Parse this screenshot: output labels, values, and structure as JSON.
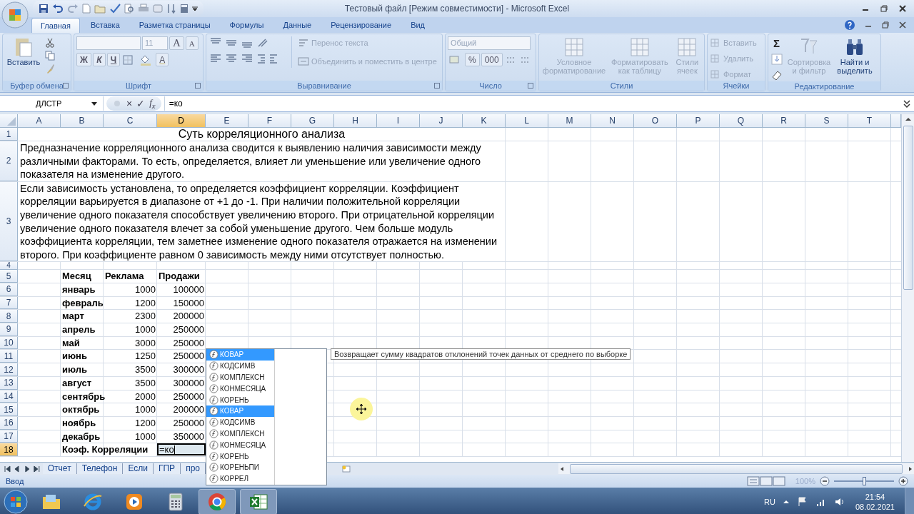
{
  "window": {
    "title": "Тестовый файл  [Режим совместимости] - Microsoft Excel"
  },
  "tabs": [
    {
      "label": "Главная",
      "selected": true
    },
    {
      "label": "Вставка",
      "selected": false
    },
    {
      "label": "Разметка страницы",
      "selected": false
    },
    {
      "label": "Формулы",
      "selected": false
    },
    {
      "label": "Данные",
      "selected": false
    },
    {
      "label": "Рецензирование",
      "selected": false
    },
    {
      "label": "Вид",
      "selected": false
    }
  ],
  "ribbon": {
    "clipboard": {
      "label": "Буфер обмена",
      "paste": {
        "label": "Вставить",
        "disabled": false
      }
    },
    "font": {
      "label": "Шрифт",
      "size": "11",
      "grow": "A",
      "shrink": "A",
      "styles": [
        "Ж",
        "К",
        "Ч"
      ],
      "color_button": "A"
    },
    "alignment": {
      "label": "Выравнивание",
      "wrap": {
        "label": "Перенос текста",
        "disabled": true
      },
      "merge": {
        "label": "Объединить и поместить в центре",
        "disabled": true
      }
    },
    "number": {
      "label": "Число",
      "format": {
        "label": "Общий",
        "disabled": true
      },
      "percent": "%",
      "thousands": "000"
    },
    "styles": {
      "label": "Стили",
      "buttons": [
        {
          "label": "Условное форматирование",
          "disabled": true
        },
        {
          "label": "Форматировать как таблицу",
          "disabled": true
        },
        {
          "label": "Стили ячеек",
          "disabled": true
        }
      ]
    },
    "cells": {
      "label": "Ячейки",
      "buttons": [
        {
          "label": "Вставить",
          "disabled": true
        },
        {
          "label": "Удалить",
          "disabled": true
        },
        {
          "label": "Формат",
          "disabled": true
        }
      ]
    },
    "editing": {
      "label": "Редактирование",
      "sum": "Σ",
      "sort": {
        "label": "Сортировка и фильтр",
        "disabled": true
      },
      "find": {
        "label": "Найти и выделить",
        "disabled": false
      }
    }
  },
  "formula_bar": {
    "name_box": "ДЛСТР",
    "cancel": "×",
    "enter": "✓",
    "function": "f$_{x}$",
    "formula": "=ко"
  },
  "sheet": {
    "columns": [
      {
        "label": "A",
        "selected": false
      },
      {
        "label": "B",
        "selected": false
      },
      {
        "label": "C",
        "selected": false
      },
      {
        "label": "D",
        "selected": true
      },
      {
        "label": "E",
        "selected": false
      },
      {
        "label": "F",
        "selected": false
      },
      {
        "label": "G",
        "selected": false
      },
      {
        "label": "H",
        "selected": false
      },
      {
        "label": "I",
        "selected": false
      },
      {
        "label": "J",
        "selected": false
      },
      {
        "label": "K",
        "selected": false
      },
      {
        "label": "L",
        "selected": false
      },
      {
        "label": "M",
        "selected": false
      },
      {
        "label": "N",
        "selected": false
      },
      {
        "label": "O",
        "selected": false
      },
      {
        "label": "P",
        "selected": false
      },
      {
        "label": "Q",
        "selected": false
      },
      {
        "label": "R",
        "selected": false
      },
      {
        "label": "S",
        "selected": false
      },
      {
        "label": "T",
        "selected": false
      }
    ],
    "rows": [
      {
        "number": "1",
        "selected": false,
        "kind": "title",
        "text": "Суть корреляционного анализа"
      },
      {
        "number": "2",
        "selected": false,
        "kind": "paragraph",
        "text": "Предназначение корреляционного анализа сводится к выявлению наличия зависимости между различными факторами. То есть, определяется, влияет ли уменьшение или увеличение одного показателя на изменение другого."
      },
      {
        "number": "3",
        "selected": false,
        "kind": "paragraph",
        "text": "Если зависимость установлена, то определяется коэффициент корреляции. Коэффициент корреляции варьируется в диапазоне от +1 до -1. При наличии положительной корреляции увеличение одного показателя способствует увеличению второго. При отрицательной корреляции увеличение одного показателя влечет за собой уменьшение другого. Чем больше модуль коэффициента корреляции, тем заметнее изменение одного показателя отражается на изменении второго. При коэффициенте равном 0 зависимость между ними отсутствует полностью."
      },
      {
        "number": "4",
        "selected": false,
        "kind": "empty"
      },
      {
        "number": "5",
        "selected": false,
        "kind": "header",
        "cells": [
          "Месяц",
          "Реклама",
          "Продажи"
        ]
      },
      {
        "number": "6",
        "selected": false,
        "kind": "data",
        "cells": [
          "январь",
          "1000",
          "100000"
        ]
      },
      {
        "number": "7",
        "selected": false,
        "kind": "data",
        "cells": [
          "февраль",
          "1200",
          "150000"
        ]
      },
      {
        "number": "8",
        "selected": false,
        "kind": "data",
        "cells": [
          "март",
          "2300",
          "200000"
        ]
      },
      {
        "number": "9",
        "selected": false,
        "kind": "data",
        "cells": [
          "апрель",
          "1000",
          "250000"
        ]
      },
      {
        "number": "10",
        "selected": false,
        "kind": "data",
        "cells": [
          "май",
          "3000",
          "250000"
        ]
      },
      {
        "number": "11",
        "selected": false,
        "kind": "data",
        "cells": [
          "июнь",
          "1250",
          "250000"
        ]
      },
      {
        "number": "12",
        "selected": false,
        "kind": "data",
        "cells": [
          "июль",
          "3500",
          "300000"
        ]
      },
      {
        "number": "13",
        "selected": false,
        "kind": "data",
        "cells": [
          "август",
          "3500",
          "300000"
        ]
      },
      {
        "number": "14",
        "selected": false,
        "kind": "data",
        "cells": [
          "сентябрь",
          "2000",
          "250000"
        ]
      },
      {
        "number": "15",
        "selected": false,
        "kind": "data",
        "cells": [
          "октябрь",
          "1000",
          "200000"
        ]
      },
      {
        "number": "16",
        "selected": false,
        "kind": "data",
        "cells": [
          "ноябрь",
          "1200",
          "250000"
        ]
      },
      {
        "number": "17",
        "selected": false,
        "kind": "data",
        "cells": [
          "декабрь",
          "1000",
          "350000"
        ]
      },
      {
        "number": "18",
        "selected": true,
        "kind": "total",
        "label": "Коэф. Корреляции",
        "input": "=ко"
      }
    ]
  },
  "sheet_tabs": [
    "Отчет",
    "Телефон",
    "Если",
    "ГПР",
    "про"
  ],
  "status_bar": {
    "mode": "Ввод",
    "zoom": "100%",
    "zoom_slider": {
      "level": 0.5
    }
  },
  "autocomplete": {
    "items": [
      {
        "label": "КОВАР",
        "selected": true
      },
      {
        "label": "КОДСИМВ",
        "selected": false
      },
      {
        "label": "КОМПЛЕКСН",
        "selected": false
      },
      {
        "label": "КОНМЕСЯЦА",
        "selected": false
      },
      {
        "label": "КОРЕНЬ",
        "selected": false
      },
      {
        "label": "КОВАР",
        "selected": true
      },
      {
        "label": "КОДСИМВ",
        "selected": false
      },
      {
        "label": "КОМПЛЕКСН",
        "selected": false
      },
      {
        "label": "КОНМЕСЯЦА",
        "selected": false
      },
      {
        "label": "КОРЕНЬ",
        "selected": false
      },
      {
        "label": "КОРЕНЬПИ",
        "selected": false
      },
      {
        "label": "КОРРЕЛ",
        "selected": false
      }
    ],
    "tooltip": "Возвращает сумму квадратов отклонений точек данных от среднего по выборке"
  },
  "taskbar": {
    "language": "RU",
    "time": "21:54",
    "date": "08.02.2021"
  }
}
